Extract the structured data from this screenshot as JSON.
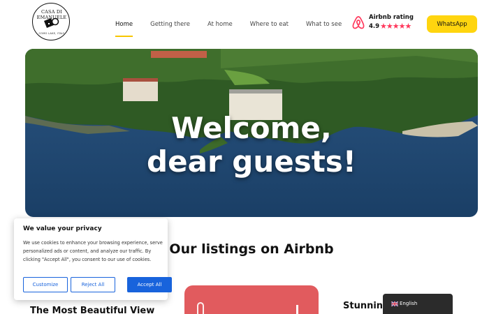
{
  "logo": {
    "top_text": "CASA DI EMANUELE",
    "bottom_text": "COMO LAKE, ITALY"
  },
  "nav": {
    "items": [
      {
        "label": "Home",
        "active": true
      },
      {
        "label": "Getting there",
        "active": false
      },
      {
        "label": "At home",
        "active": false
      },
      {
        "label": "Where to eat",
        "active": false
      },
      {
        "label": "What to see",
        "active": false
      }
    ]
  },
  "rating": {
    "label": "Airbnb rating",
    "score": "4.9",
    "stars": 5,
    "icon": "airbnb-icon"
  },
  "whatsapp": {
    "label": "WhatsApp"
  },
  "hero": {
    "line1": "Welcome,",
    "line2": "dear guests!"
  },
  "listings": {
    "title": "Our listings on Airbnb",
    "left_title": "The Most Beautiful View",
    "right_title": "Stunning"
  },
  "cookie": {
    "title": "We value your privacy",
    "text": "We use cookies to enhance your browsing experience, serve personalized ads or content, and analyze our traffic. By clicking \"Accept All\", you consent to our use of cookies.",
    "customize": "Customize",
    "reject": "Reject All",
    "accept": "Accept All"
  },
  "language": {
    "label": "English",
    "icon": "uk-flag-icon"
  },
  "colors": {
    "accent": "#ffd50f",
    "airbnb": "#ff385c",
    "cookie_primary": "#1863dc"
  }
}
